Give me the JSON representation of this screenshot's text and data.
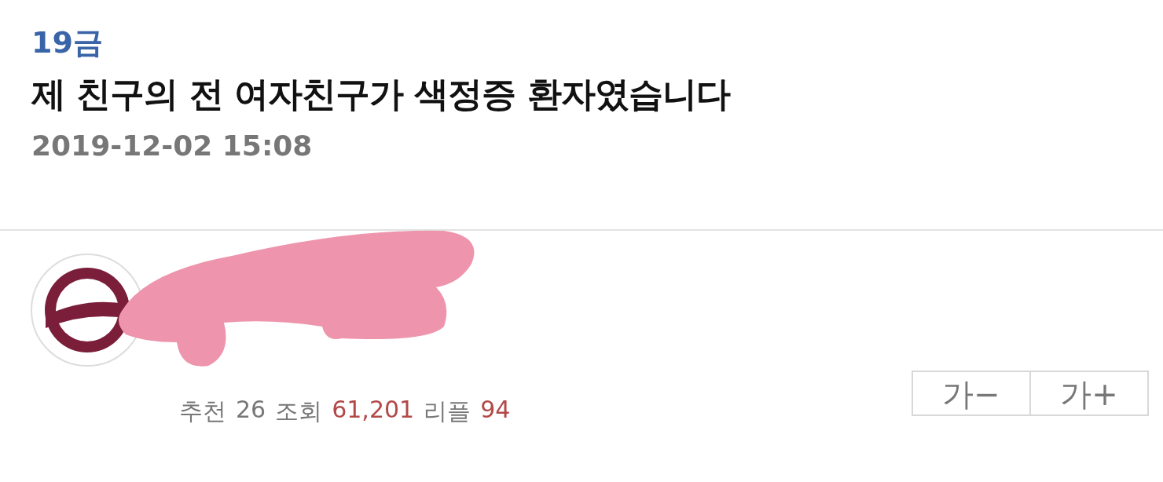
{
  "post": {
    "category": "19금",
    "title": "제 친구의 전 여자친구가 색정증 환자였습니다",
    "date": "2019-12-02 15:08"
  },
  "author": {
    "avatar": {
      "kind": "emblem"
    },
    "redacted": true
  },
  "stats": [
    {
      "label": "추천",
      "value": "26",
      "highlight": false
    },
    {
      "label": "조회",
      "value": "61,201",
      "highlight": true
    },
    {
      "label": "리플",
      "value": "94",
      "highlight": true
    }
  ],
  "font_buttons": [
    "가−",
    "가+"
  ]
}
